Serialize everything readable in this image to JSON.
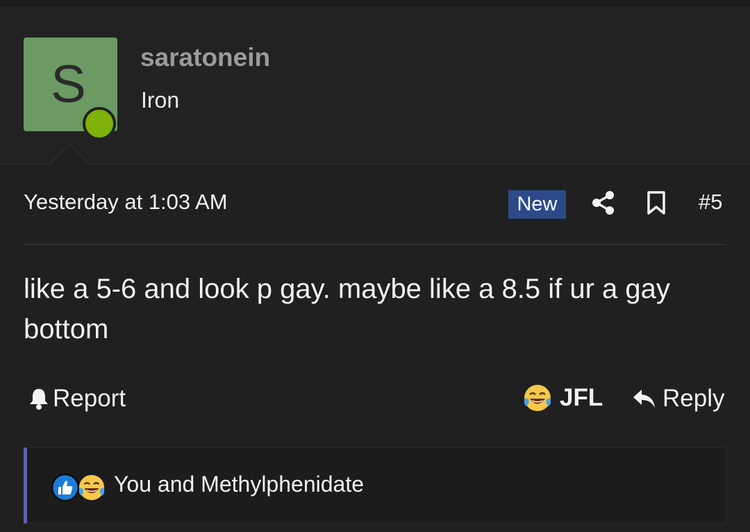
{
  "author": {
    "avatar_letter": "S",
    "username": "saratonein",
    "title": "Iron",
    "avatar_color": "#6b9a63",
    "online_color": "#7fb20a"
  },
  "post": {
    "date": "Yesterday at 1:03 AM",
    "new_badge": "New",
    "number": "#5",
    "message": "like a 5-6 and look p gay. maybe like a 8.5 if ur a gay bottom"
  },
  "actions": {
    "report_label": "Report",
    "reaction_label": "JFL",
    "reply_label": "Reply"
  },
  "reactions": {
    "users_text": "You and Methylphenidate",
    "icons": [
      "like-icon",
      "laugh-cry-icon"
    ]
  },
  "colors": {
    "background": "#202020",
    "badge": "#2c4a8a",
    "reactions_accent": "#5b63b0"
  }
}
